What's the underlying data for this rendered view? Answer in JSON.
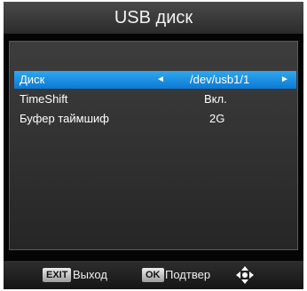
{
  "title": "USB диск",
  "menu": [
    {
      "label": "Диск",
      "value": "/dev/usb1/1",
      "selected": true
    },
    {
      "label": "TimeShift",
      "value": "Вкл."
    },
    {
      "label": "Буфер таймшиф",
      "value": "2G"
    }
  ],
  "footer": {
    "exit_key": "EXIT",
    "exit_label": "Выход",
    "ok_key": "OK",
    "ok_label": "Подтвер",
    "nav_icon": "dpad-icon"
  },
  "colors": {
    "highlight": "#1a8ce0",
    "background": "#050505"
  }
}
